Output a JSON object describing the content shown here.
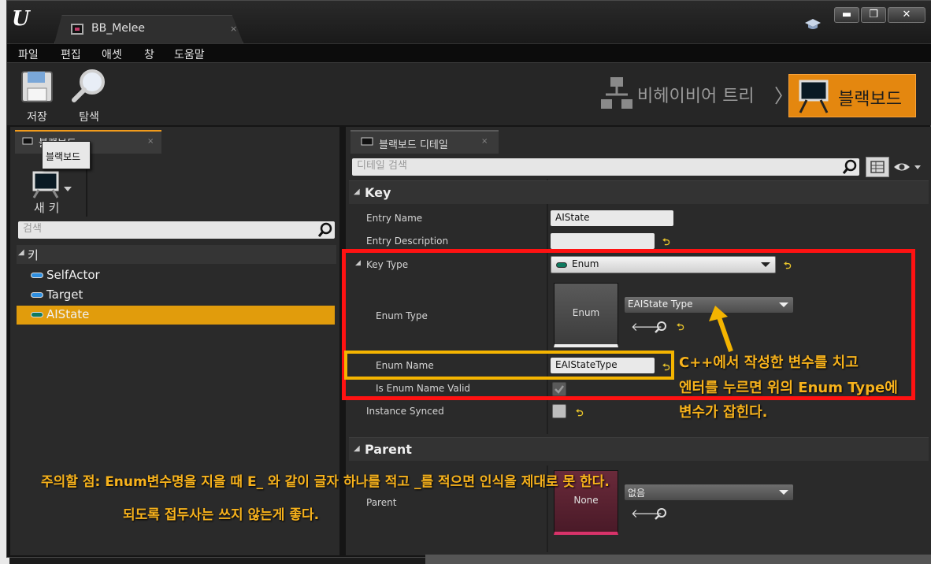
{
  "window": {
    "logo": "U",
    "tab_label": "BB_Melee",
    "tab_close": "×",
    "minimize": "▬",
    "maximize": "❐",
    "close": "✕"
  },
  "menu": [
    "파일",
    "편집",
    "애셋",
    "창",
    "도움말"
  ],
  "toolbar": {
    "save_label": "저장",
    "browse_label": "탐색",
    "mode_behavior_tree": "비헤이비어 트리",
    "mode_chevron": "〉",
    "mode_blackboard": "블랙보드"
  },
  "left_panel": {
    "tab_label": "블랙보드",
    "tab_close": "×",
    "tooltip": "블랙보드",
    "new_key_label": "새 키",
    "search_placeholder": "검색",
    "category_label": "키",
    "keys": [
      {
        "name": "SelfActor",
        "color": "#2f8fe0"
      },
      {
        "name": "Target",
        "color": "#2f8fe0"
      },
      {
        "name": "AIState",
        "color": "#0f7a60"
      }
    ],
    "selected_key": "AIState"
  },
  "details": {
    "tab_label": "블랙보드 디테일",
    "tab_close": "×",
    "search_placeholder": "디테일 검색",
    "key_category": "Key",
    "entry_name_label": "Entry Name",
    "entry_name_value": "AIState",
    "entry_desc_label": "Entry Description",
    "entry_desc_value": "",
    "key_type_label": "Key Type",
    "key_type_value": "Enum",
    "enum_type_label": "Enum Type",
    "enum_thumb_label": "Enum",
    "enum_type_value": "EAIState Type",
    "enum_name_label": "Enum Name",
    "enum_name_value": "EAIStateType",
    "enum_name_valid_label": "Is Enum Name Valid",
    "instance_synced_label": "Instance Synced",
    "parent_category": "Parent",
    "parent_label": "Parent",
    "parent_thumb_label": "None",
    "parent_value": "없음",
    "reset_glyph": "⮌"
  },
  "annotations": {
    "note1_line1": "C++에서 작성한 변수를 치고",
    "note1_line2": "엔터를 누르면 위의 Enum Type에",
    "note1_line3": "변수가 잡힌다.",
    "note2_line1": "주의할 점: Enum변수명을 지을 때 E_ 와 같이 글자 하나를 적고 _를 적으면 인식을 제대로 못 한다.",
    "note2_line2": "되도록 접두사는 쓰지 않는게 좋다.",
    "highlight_red": "#ff1212",
    "highlight_yellow": "#f4b400"
  }
}
